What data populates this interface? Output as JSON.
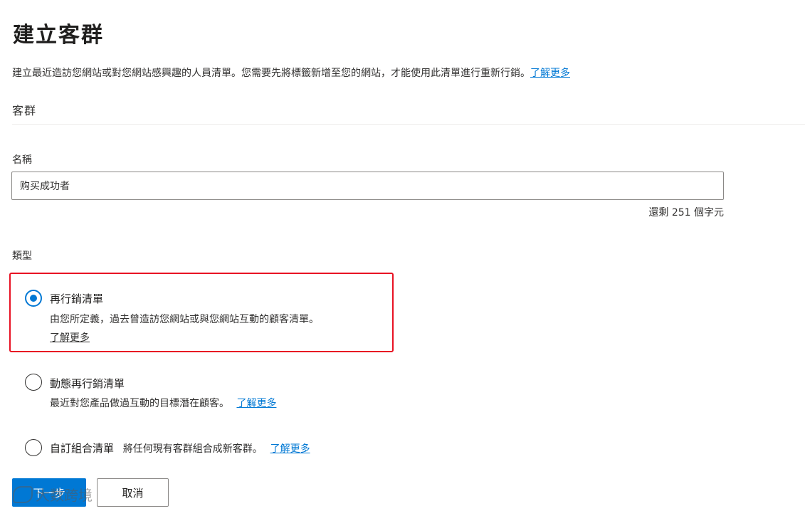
{
  "page": {
    "title": "建立客群",
    "description": "建立最近造訪您網站或對您網站感興趣的人員清單。您需要先將標籤新增至您的網站，才能使用此清單進行重新行銷。",
    "learn_more": "了解更多"
  },
  "section": {
    "heading": "客群"
  },
  "name_field": {
    "label": "名稱",
    "value": "购买成功者",
    "char_count": "還剩 251 個字元"
  },
  "type_field": {
    "label": "類型",
    "options": [
      {
        "title": "再行銷清單",
        "description": "由您所定義，過去曾造訪您網站或與您網站互動的顧客清單。",
        "link": "了解更多",
        "selected": true
      },
      {
        "title": "動態再行銷清單",
        "description": "最近對您產品做過互動的目標潛在顧客。",
        "link": "了解更多",
        "selected": false
      },
      {
        "title": "自訂組合清單",
        "description": "將任何現有客群組合成新客群。",
        "link": "了解更多",
        "selected": false
      }
    ]
  },
  "buttons": {
    "next": "下一步",
    "cancel": "取消"
  },
  "watermark": {
    "text": "大数跨境"
  },
  "colors": {
    "accent": "#0078d4",
    "highlight": "#e81123"
  }
}
